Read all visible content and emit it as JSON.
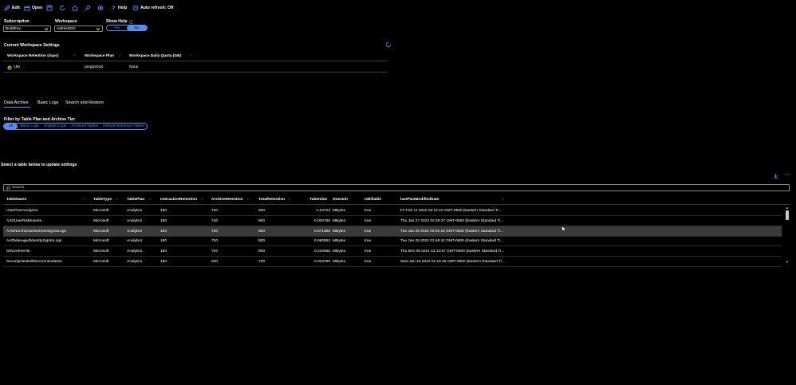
{
  "toolbar": {
    "edit": "Edit",
    "open": "Open",
    "help": "Help",
    "auto_refresh": "Auto refresh: Off"
  },
  "filters": {
    "subscription_label": "Subscription",
    "subscription_value": "BuildEnv",
    "workspace_label": "Workspace",
    "workspace_value": "AdminSOC",
    "show_help_label": "Show Help",
    "show_help_yes": "Yes",
    "show_help_no": "No",
    "show_help_selected": "No"
  },
  "settings": {
    "title": "Current Workspace Settings",
    "headers": [
      "Workspace Retention (days)",
      "Workspace Plan",
      "Workspace Daily Quota (GB)"
    ],
    "row": [
      "180",
      "pergb2018",
      "None"
    ]
  },
  "tabs": [
    "Data Archive",
    "Basic Logs",
    "Search and Restore"
  ],
  "filter_tier": {
    "label": "Filter by Table Plan and Archive Tier",
    "options": [
      "All",
      "Basic Logs",
      "Analytic Logs",
      "Archived Tables",
      "Default Retention Tables"
    ],
    "selected": "All"
  },
  "table_section": {
    "prompt": "Select a table below to update settings",
    "search_placeholder": "Search"
  },
  "table": {
    "columns": [
      "TableName",
      "TableType",
      "TablePlan",
      "InteractiveRetention",
      "ArchiveRetention",
      "TotalRetention",
      "TableSize",
      "SizeUnit",
      "IsBillable",
      "lastPlanModifiedDate"
    ],
    "rows": [
      [
        "UserPeerAnalytics",
        "Microsoft",
        "Analytics",
        "180",
        "720",
        "900",
        "1.04723",
        "MBytes",
        "true",
        "Fri Feb 11 2022 02:12:22 GMT-0500 (Eastern Standard Ti..."
      ],
      [
        "AADUserRiskEvents",
        "Microsoft",
        "Analytics",
        "180",
        "720",
        "900",
        "0.000798",
        "MBytes",
        "true",
        "Thu Jan 27 2022 02:29:37 GMT-0500 (Eastern Standard Ti..."
      ],
      [
        "AADNonInteractiveUserSignInLogs",
        "Microsoft",
        "Analytics",
        "180",
        "720",
        "900",
        "0.071356",
        "MBytes",
        "true",
        "Tue Jan 25 2022 02:02:10 GMT-0500 (Eastern Standard Ti..."
      ],
      [
        "AADManagedIdentitySignInLogs",
        "Microsoft",
        "Analytics",
        "180",
        "720",
        "900",
        "0.050564",
        "MBytes",
        "true",
        "Tue Jan 25 2022 01:46:42 GMT-0500 (Eastern Standard Ti..."
      ],
      [
        "DeviceEvents",
        "Microsoft",
        "Analytics",
        "180",
        "720",
        "900",
        "0.232655",
        "MBytes",
        "true",
        "Thu Dec 09 2021 13:14:57 GMT-0500 (Eastern Standard Ti..."
      ],
      [
        "SecurityNestedRecommendation",
        "Microsoft",
        "Analytics",
        "180",
        "550",
        "730",
        "0.023789",
        "MBytes",
        "true",
        "Wed Jan 19 2022 01:16:45 GMT-0500 (Eastern Standard Ti..."
      ]
    ],
    "selected_row": 2
  },
  "colors": {
    "accent": "#5b8def",
    "background": "#000000",
    "selected_row": "#3b3a39",
    "check_green": "#8cbd18"
  },
  "icons": [
    "edit-icon",
    "open-icon",
    "save-icon",
    "refresh-icon",
    "home-icon",
    "pin-icon",
    "settings-icon",
    "help-icon",
    "clock-icon",
    "info-icon",
    "spinner-icon",
    "check-icon",
    "download-icon",
    "more-icon",
    "search-icon",
    "sort-icon"
  ]
}
